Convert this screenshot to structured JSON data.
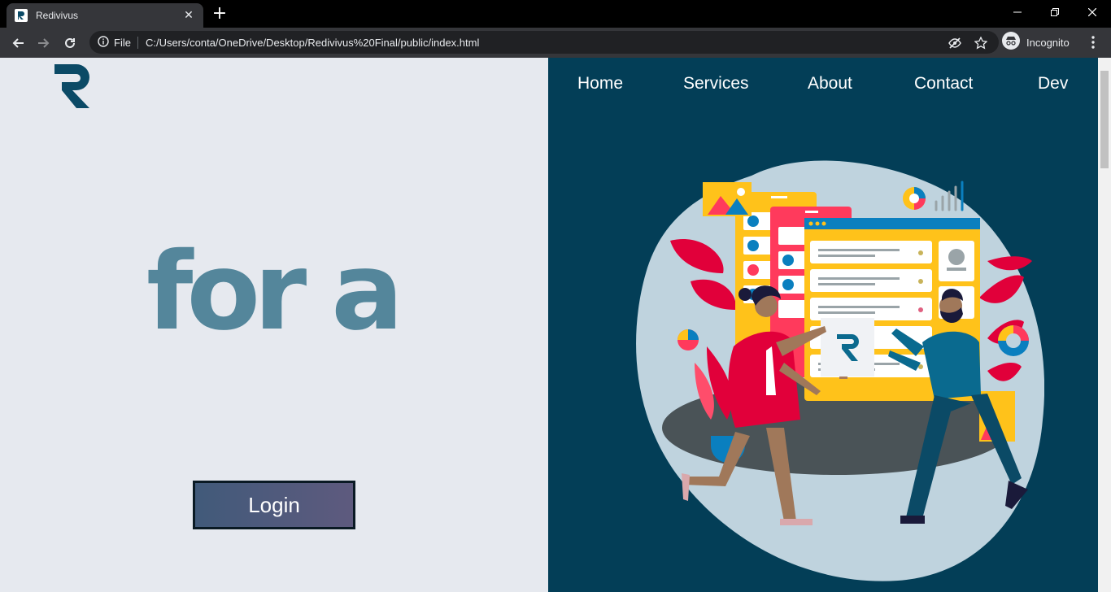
{
  "browser": {
    "tab_title": "Redivivus",
    "tab_close": "✕",
    "new_tab": "+",
    "address_scheme": "File",
    "address_url": "C:/Users/conta/OneDrive/Desktop/Redivivus%20Final/public/index.html",
    "profile_label": "Incognito"
  },
  "nav": {
    "items": [
      "Home",
      "Services",
      "About",
      "Contact",
      "Dev"
    ]
  },
  "hero": {
    "headline": "for a"
  },
  "login": {
    "label": "Login"
  },
  "colors": {
    "left_bg": "#e6e9ef",
    "right_bg": "#033e57",
    "headline": "#54869b",
    "brand": "#0b4a66"
  }
}
